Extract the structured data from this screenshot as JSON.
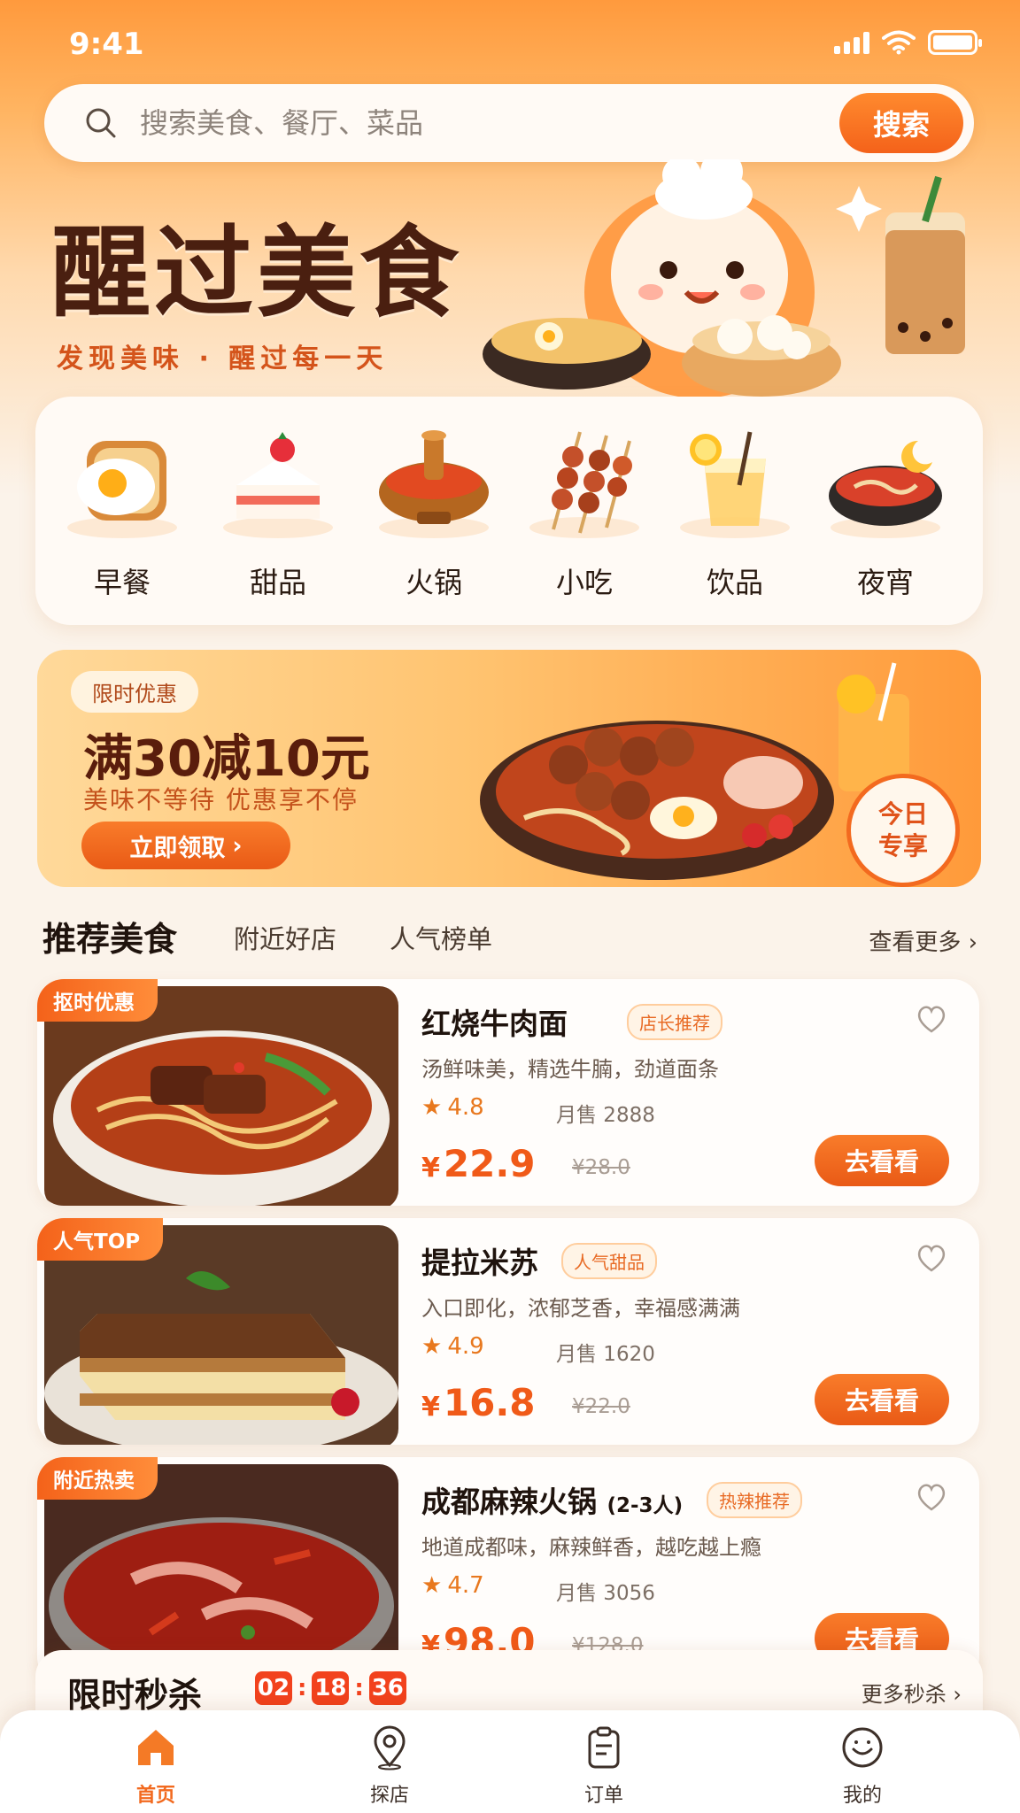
{
  "status_bar": {
    "time": "9:41"
  },
  "search": {
    "placeholder": "搜索美食、餐厅、菜品",
    "button_label": "搜索"
  },
  "hero": {
    "title": "醒过美食",
    "subtitle": "发现美味 · 醒过每一天"
  },
  "categories": [
    {
      "label": "早餐",
      "icon": "fried-egg-toast-icon"
    },
    {
      "label": "甜品",
      "icon": "cake-icon"
    },
    {
      "label": "火锅",
      "icon": "hotpot-icon"
    },
    {
      "label": "小吃",
      "icon": "skewer-icon"
    },
    {
      "label": "饮品",
      "icon": "drink-icon"
    },
    {
      "label": "夜宵",
      "icon": "night-noodle-icon"
    }
  ],
  "promo": {
    "tag": "限时优惠",
    "headline": "满30减10元",
    "subtitle": "美味不等待  优惠享不停",
    "button_label": "立即领取",
    "badge_line1": "今日",
    "badge_line2": "专享"
  },
  "tabs": {
    "active": "推荐美食",
    "items": [
      "附近好店",
      "人气榜单"
    ],
    "see_more": "查看更多"
  },
  "foods": [
    {
      "ribbon": "抠时优惠",
      "name": "红烧牛肉面",
      "name_suffix": "",
      "badge": "店长推荐",
      "desc": "汤鲜味美，精选牛腩，劲道面条",
      "rating": "4.8",
      "sales": "月售 2888",
      "price": "22.9",
      "old_price": "¥28.0",
      "button": "去看看"
    },
    {
      "ribbon": "人气TOP",
      "name": "提拉米苏",
      "name_suffix": "",
      "badge": "人气甜品",
      "desc": "入口即化，浓郁芝香，幸福感满满",
      "rating": "4.9",
      "sales": "月售 1620",
      "price": "16.8",
      "old_price": "¥22.0",
      "button": "去看看"
    },
    {
      "ribbon": "附近热卖",
      "name": "成都麻辣火锅",
      "name_suffix": "(2-3人)",
      "badge": "热辣推荐",
      "desc": "地道成都味，麻辣鲜香，越吃越上瘾",
      "rating": "4.7",
      "sales": "月售 3056",
      "price": "98.0",
      "old_price": "¥128.0",
      "button": "去看看"
    }
  ],
  "currency": "¥",
  "flash_sale": {
    "title": "限时秒杀",
    "hours": "02",
    "minutes": "18",
    "seconds": "36",
    "more": "更多秒杀"
  },
  "nav": [
    {
      "label": "首页",
      "icon": "home-icon",
      "active": true
    },
    {
      "label": "探店",
      "icon": "location-pin-icon",
      "active": false
    },
    {
      "label": "订单",
      "icon": "clipboard-icon",
      "active": false
    },
    {
      "label": "我的",
      "icon": "smiley-icon",
      "active": false
    }
  ],
  "colors": {
    "accent": "#f26a1f",
    "title_brown": "#4a1f10",
    "price": "#f05a18"
  }
}
